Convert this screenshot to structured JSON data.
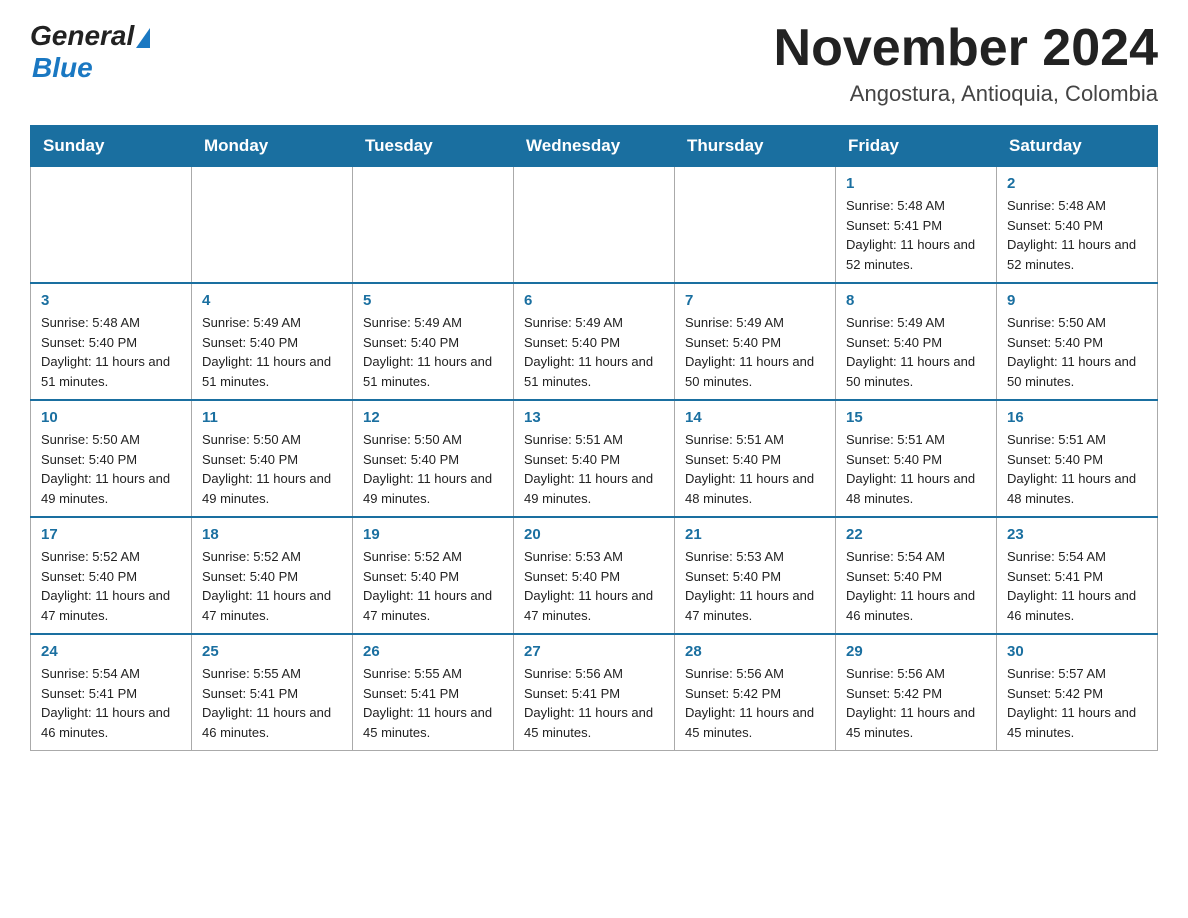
{
  "header": {
    "logo_general": "General",
    "logo_blue": "Blue",
    "month_title": "November 2024",
    "location": "Angostura, Antioquia, Colombia"
  },
  "days_of_week": [
    "Sunday",
    "Monday",
    "Tuesday",
    "Wednesday",
    "Thursday",
    "Friday",
    "Saturday"
  ],
  "weeks": [
    [
      {
        "day": "",
        "info": ""
      },
      {
        "day": "",
        "info": ""
      },
      {
        "day": "",
        "info": ""
      },
      {
        "day": "",
        "info": ""
      },
      {
        "day": "",
        "info": ""
      },
      {
        "day": "1",
        "info": "Sunrise: 5:48 AM\nSunset: 5:41 PM\nDaylight: 11 hours and 52 minutes."
      },
      {
        "day": "2",
        "info": "Sunrise: 5:48 AM\nSunset: 5:40 PM\nDaylight: 11 hours and 52 minutes."
      }
    ],
    [
      {
        "day": "3",
        "info": "Sunrise: 5:48 AM\nSunset: 5:40 PM\nDaylight: 11 hours and 51 minutes."
      },
      {
        "day": "4",
        "info": "Sunrise: 5:49 AM\nSunset: 5:40 PM\nDaylight: 11 hours and 51 minutes."
      },
      {
        "day": "5",
        "info": "Sunrise: 5:49 AM\nSunset: 5:40 PM\nDaylight: 11 hours and 51 minutes."
      },
      {
        "day": "6",
        "info": "Sunrise: 5:49 AM\nSunset: 5:40 PM\nDaylight: 11 hours and 51 minutes."
      },
      {
        "day": "7",
        "info": "Sunrise: 5:49 AM\nSunset: 5:40 PM\nDaylight: 11 hours and 50 minutes."
      },
      {
        "day": "8",
        "info": "Sunrise: 5:49 AM\nSunset: 5:40 PM\nDaylight: 11 hours and 50 minutes."
      },
      {
        "day": "9",
        "info": "Sunrise: 5:50 AM\nSunset: 5:40 PM\nDaylight: 11 hours and 50 minutes."
      }
    ],
    [
      {
        "day": "10",
        "info": "Sunrise: 5:50 AM\nSunset: 5:40 PM\nDaylight: 11 hours and 49 minutes."
      },
      {
        "day": "11",
        "info": "Sunrise: 5:50 AM\nSunset: 5:40 PM\nDaylight: 11 hours and 49 minutes."
      },
      {
        "day": "12",
        "info": "Sunrise: 5:50 AM\nSunset: 5:40 PM\nDaylight: 11 hours and 49 minutes."
      },
      {
        "day": "13",
        "info": "Sunrise: 5:51 AM\nSunset: 5:40 PM\nDaylight: 11 hours and 49 minutes."
      },
      {
        "day": "14",
        "info": "Sunrise: 5:51 AM\nSunset: 5:40 PM\nDaylight: 11 hours and 48 minutes."
      },
      {
        "day": "15",
        "info": "Sunrise: 5:51 AM\nSunset: 5:40 PM\nDaylight: 11 hours and 48 minutes."
      },
      {
        "day": "16",
        "info": "Sunrise: 5:51 AM\nSunset: 5:40 PM\nDaylight: 11 hours and 48 minutes."
      }
    ],
    [
      {
        "day": "17",
        "info": "Sunrise: 5:52 AM\nSunset: 5:40 PM\nDaylight: 11 hours and 47 minutes."
      },
      {
        "day": "18",
        "info": "Sunrise: 5:52 AM\nSunset: 5:40 PM\nDaylight: 11 hours and 47 minutes."
      },
      {
        "day": "19",
        "info": "Sunrise: 5:52 AM\nSunset: 5:40 PM\nDaylight: 11 hours and 47 minutes."
      },
      {
        "day": "20",
        "info": "Sunrise: 5:53 AM\nSunset: 5:40 PM\nDaylight: 11 hours and 47 minutes."
      },
      {
        "day": "21",
        "info": "Sunrise: 5:53 AM\nSunset: 5:40 PM\nDaylight: 11 hours and 47 minutes."
      },
      {
        "day": "22",
        "info": "Sunrise: 5:54 AM\nSunset: 5:40 PM\nDaylight: 11 hours and 46 minutes."
      },
      {
        "day": "23",
        "info": "Sunrise: 5:54 AM\nSunset: 5:41 PM\nDaylight: 11 hours and 46 minutes."
      }
    ],
    [
      {
        "day": "24",
        "info": "Sunrise: 5:54 AM\nSunset: 5:41 PM\nDaylight: 11 hours and 46 minutes."
      },
      {
        "day": "25",
        "info": "Sunrise: 5:55 AM\nSunset: 5:41 PM\nDaylight: 11 hours and 46 minutes."
      },
      {
        "day": "26",
        "info": "Sunrise: 5:55 AM\nSunset: 5:41 PM\nDaylight: 11 hours and 45 minutes."
      },
      {
        "day": "27",
        "info": "Sunrise: 5:56 AM\nSunset: 5:41 PM\nDaylight: 11 hours and 45 minutes."
      },
      {
        "day": "28",
        "info": "Sunrise: 5:56 AM\nSunset: 5:42 PM\nDaylight: 11 hours and 45 minutes."
      },
      {
        "day": "29",
        "info": "Sunrise: 5:56 AM\nSunset: 5:42 PM\nDaylight: 11 hours and 45 minutes."
      },
      {
        "day": "30",
        "info": "Sunrise: 5:57 AM\nSunset: 5:42 PM\nDaylight: 11 hours and 45 minutes."
      }
    ]
  ]
}
